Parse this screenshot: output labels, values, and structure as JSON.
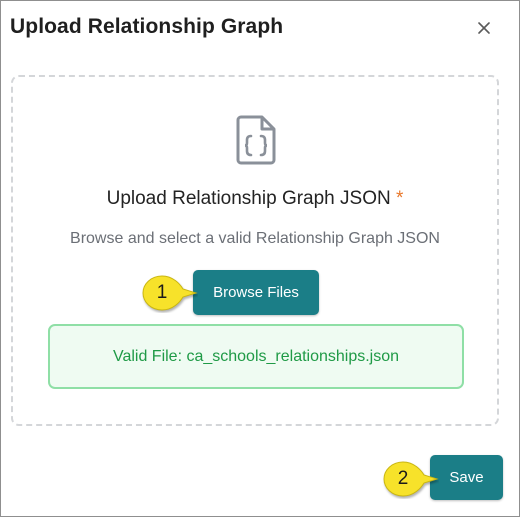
{
  "dialog": {
    "title": "Upload Relationship Graph",
    "close_glyph": "×",
    "close_icon": "close-icon"
  },
  "dropzone": {
    "icon": "json-file-icon",
    "heading": "Upload Relationship Graph JSON",
    "required_marker": "*",
    "subtext": "Browse and select a valid Relationship Graph JSON",
    "browse_label": "Browse Files",
    "valid_file_text": "Valid File: ca_schools_relationships.json"
  },
  "footer": {
    "save_label": "Save"
  },
  "callouts": [
    {
      "number": "1"
    },
    {
      "number": "2"
    }
  ],
  "colors": {
    "primary": "#1b7e87",
    "success_text": "#1f9a46",
    "success_border": "#8fdfa6",
    "success_bg": "#effbf2",
    "required": "#e8772a",
    "callout_fill": "#f7e22a"
  }
}
